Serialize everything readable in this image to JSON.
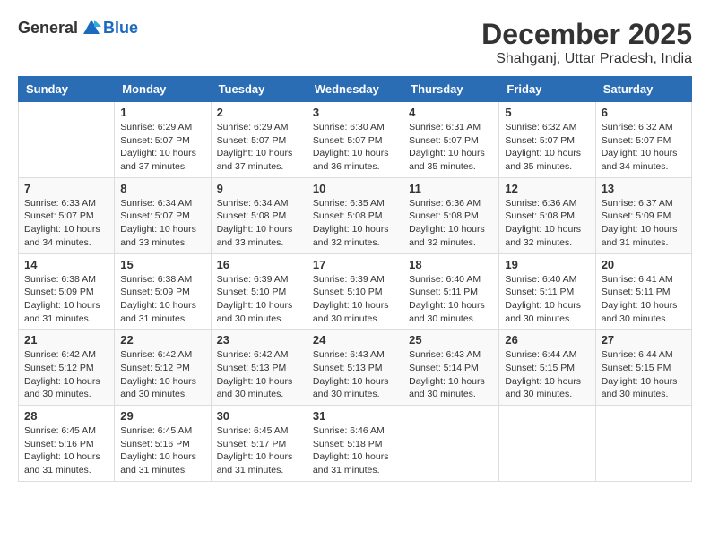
{
  "logo": {
    "general": "General",
    "blue": "Blue"
  },
  "header": {
    "month_year": "December 2025",
    "location": "Shahganj, Uttar Pradesh, India"
  },
  "weekdays": [
    "Sunday",
    "Monday",
    "Tuesday",
    "Wednesday",
    "Thursday",
    "Friday",
    "Saturday"
  ],
  "weeks": [
    [
      {
        "day": "",
        "info": ""
      },
      {
        "day": "1",
        "info": "Sunrise: 6:29 AM\nSunset: 5:07 PM\nDaylight: 10 hours and 37 minutes."
      },
      {
        "day": "2",
        "info": "Sunrise: 6:29 AM\nSunset: 5:07 PM\nDaylight: 10 hours and 37 minutes."
      },
      {
        "day": "3",
        "info": "Sunrise: 6:30 AM\nSunset: 5:07 PM\nDaylight: 10 hours and 36 minutes."
      },
      {
        "day": "4",
        "info": "Sunrise: 6:31 AM\nSunset: 5:07 PM\nDaylight: 10 hours and 35 minutes."
      },
      {
        "day": "5",
        "info": "Sunrise: 6:32 AM\nSunset: 5:07 PM\nDaylight: 10 hours and 35 minutes."
      },
      {
        "day": "6",
        "info": "Sunrise: 6:32 AM\nSunset: 5:07 PM\nDaylight: 10 hours and 34 minutes."
      }
    ],
    [
      {
        "day": "7",
        "info": "Sunrise: 6:33 AM\nSunset: 5:07 PM\nDaylight: 10 hours and 34 minutes."
      },
      {
        "day": "8",
        "info": "Sunrise: 6:34 AM\nSunset: 5:07 PM\nDaylight: 10 hours and 33 minutes."
      },
      {
        "day": "9",
        "info": "Sunrise: 6:34 AM\nSunset: 5:08 PM\nDaylight: 10 hours and 33 minutes."
      },
      {
        "day": "10",
        "info": "Sunrise: 6:35 AM\nSunset: 5:08 PM\nDaylight: 10 hours and 32 minutes."
      },
      {
        "day": "11",
        "info": "Sunrise: 6:36 AM\nSunset: 5:08 PM\nDaylight: 10 hours and 32 minutes."
      },
      {
        "day": "12",
        "info": "Sunrise: 6:36 AM\nSunset: 5:08 PM\nDaylight: 10 hours and 32 minutes."
      },
      {
        "day": "13",
        "info": "Sunrise: 6:37 AM\nSunset: 5:09 PM\nDaylight: 10 hours and 31 minutes."
      }
    ],
    [
      {
        "day": "14",
        "info": "Sunrise: 6:38 AM\nSunset: 5:09 PM\nDaylight: 10 hours and 31 minutes."
      },
      {
        "day": "15",
        "info": "Sunrise: 6:38 AM\nSunset: 5:09 PM\nDaylight: 10 hours and 31 minutes."
      },
      {
        "day": "16",
        "info": "Sunrise: 6:39 AM\nSunset: 5:10 PM\nDaylight: 10 hours and 30 minutes."
      },
      {
        "day": "17",
        "info": "Sunrise: 6:39 AM\nSunset: 5:10 PM\nDaylight: 10 hours and 30 minutes."
      },
      {
        "day": "18",
        "info": "Sunrise: 6:40 AM\nSunset: 5:11 PM\nDaylight: 10 hours and 30 minutes."
      },
      {
        "day": "19",
        "info": "Sunrise: 6:40 AM\nSunset: 5:11 PM\nDaylight: 10 hours and 30 minutes."
      },
      {
        "day": "20",
        "info": "Sunrise: 6:41 AM\nSunset: 5:11 PM\nDaylight: 10 hours and 30 minutes."
      }
    ],
    [
      {
        "day": "21",
        "info": "Sunrise: 6:42 AM\nSunset: 5:12 PM\nDaylight: 10 hours and 30 minutes."
      },
      {
        "day": "22",
        "info": "Sunrise: 6:42 AM\nSunset: 5:12 PM\nDaylight: 10 hours and 30 minutes."
      },
      {
        "day": "23",
        "info": "Sunrise: 6:42 AM\nSunset: 5:13 PM\nDaylight: 10 hours and 30 minutes."
      },
      {
        "day": "24",
        "info": "Sunrise: 6:43 AM\nSunset: 5:13 PM\nDaylight: 10 hours and 30 minutes."
      },
      {
        "day": "25",
        "info": "Sunrise: 6:43 AM\nSunset: 5:14 PM\nDaylight: 10 hours and 30 minutes."
      },
      {
        "day": "26",
        "info": "Sunrise: 6:44 AM\nSunset: 5:15 PM\nDaylight: 10 hours and 30 minutes."
      },
      {
        "day": "27",
        "info": "Sunrise: 6:44 AM\nSunset: 5:15 PM\nDaylight: 10 hours and 30 minutes."
      }
    ],
    [
      {
        "day": "28",
        "info": "Sunrise: 6:45 AM\nSunset: 5:16 PM\nDaylight: 10 hours and 31 minutes."
      },
      {
        "day": "29",
        "info": "Sunrise: 6:45 AM\nSunset: 5:16 PM\nDaylight: 10 hours and 31 minutes."
      },
      {
        "day": "30",
        "info": "Sunrise: 6:45 AM\nSunset: 5:17 PM\nDaylight: 10 hours and 31 minutes."
      },
      {
        "day": "31",
        "info": "Sunrise: 6:46 AM\nSunset: 5:18 PM\nDaylight: 10 hours and 31 minutes."
      },
      {
        "day": "",
        "info": ""
      },
      {
        "day": "",
        "info": ""
      },
      {
        "day": "",
        "info": ""
      }
    ]
  ]
}
